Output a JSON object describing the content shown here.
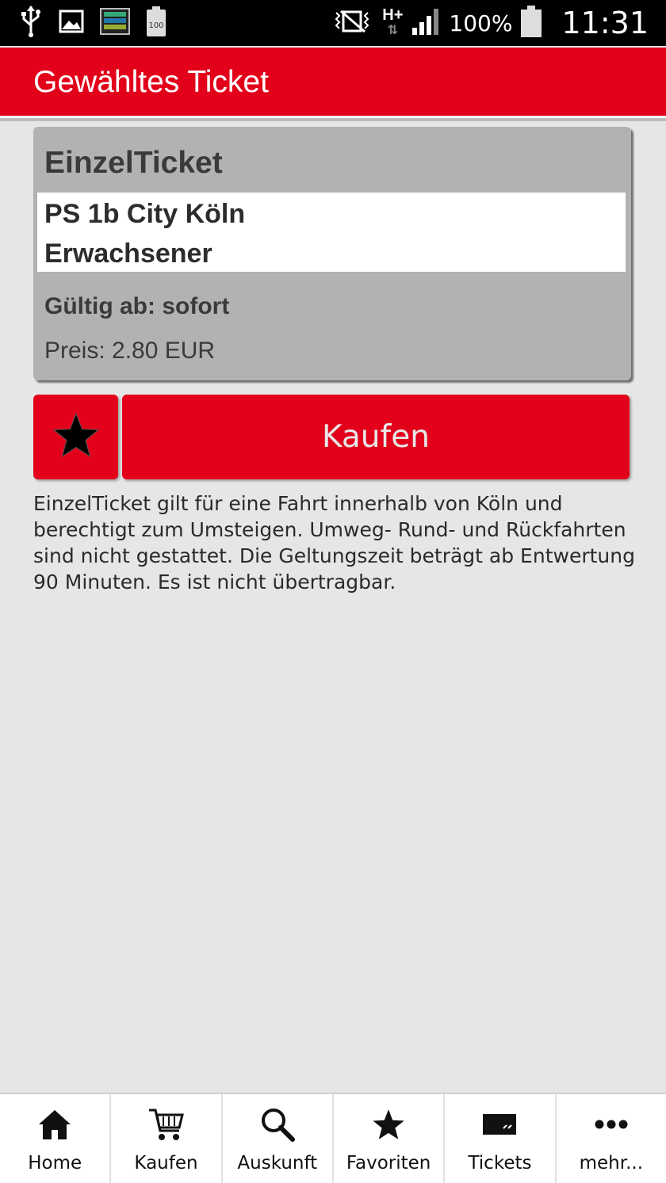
{
  "status_bar": {
    "battery_percent": "100%",
    "battery_icon_text": "100",
    "network": "H+",
    "time": "11:31"
  },
  "header": {
    "title": "Gewähltes Ticket"
  },
  "ticket": {
    "type": "EinzelTicket",
    "route": "PS 1b City Köln",
    "passenger": "Erwachsener",
    "valid_from": "Gültig ab: sofort",
    "price": "Preis: 2.80 EUR"
  },
  "actions": {
    "buy_label": "Kaufen"
  },
  "description": "EinzelTicket gilt für eine Fahrt innerhalb von Köln und berechtigt zum Umsteigen. Umweg- Rund- und Rückfahrten sind nicht gestattet. Die Geltungszeit beträgt ab Entwertung 90 Minuten. Es ist nicht übertragbar.",
  "nav": {
    "items": [
      {
        "label": "Home",
        "icon": "home-icon"
      },
      {
        "label": "Kaufen",
        "icon": "cart-icon"
      },
      {
        "label": "Auskunft",
        "icon": "search-icon"
      },
      {
        "label": "Favoriten",
        "icon": "star-icon"
      },
      {
        "label": "Tickets",
        "icon": "ticket-icon"
      },
      {
        "label": "mehr...",
        "icon": "more-icon"
      }
    ]
  },
  "colors": {
    "brand_red": "#e2001a",
    "background": "#e6e6e6",
    "card_gray": "#b2b2b2"
  }
}
